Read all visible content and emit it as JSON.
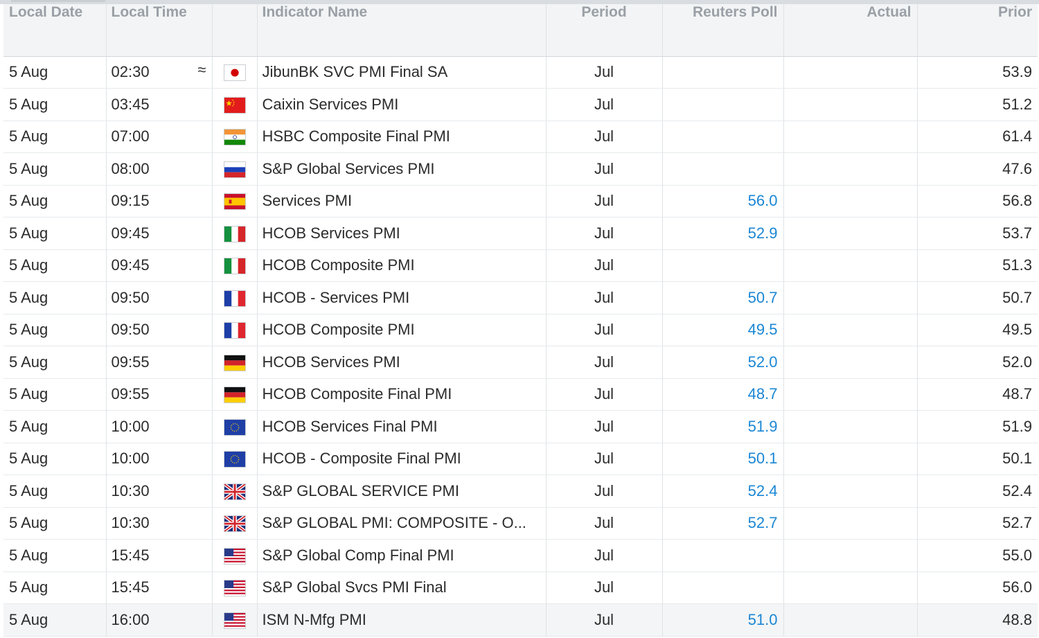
{
  "columns": {
    "local_date": "Local Date",
    "local_time": "Local Time",
    "flag": "",
    "indicator_name": "Indicator Name",
    "period": "Period",
    "reuters_poll": "Reuters Poll",
    "actual": "Actual",
    "prior": "Prior"
  },
  "rows": [
    {
      "date": "5 Aug",
      "time": "02:30",
      "approx": "≈",
      "country": "japan-flag-icon",
      "name": "JibunBK SVC PMI Final SA",
      "period": "Jul",
      "poll": "",
      "actual": "",
      "prior": "53.9"
    },
    {
      "date": "5 Aug",
      "time": "03:45",
      "approx": "",
      "country": "china-flag-icon",
      "name": "Caixin Services PMI",
      "period": "Jul",
      "poll": "",
      "actual": "",
      "prior": "51.2"
    },
    {
      "date": "5 Aug",
      "time": "07:00",
      "approx": "",
      "country": "india-flag-icon",
      "name": "HSBC Composite Final PMI",
      "period": "Jul",
      "poll": "",
      "actual": "",
      "prior": "61.4"
    },
    {
      "date": "5 Aug",
      "time": "08:00",
      "approx": "",
      "country": "russia-flag-icon",
      "name": "S&P Global Services PMI",
      "period": "Jul",
      "poll": "",
      "actual": "",
      "prior": "47.6"
    },
    {
      "date": "5 Aug",
      "time": "09:15",
      "approx": "",
      "country": "spain-flag-icon",
      "name": "Services PMI",
      "period": "Jul",
      "poll": "56.0",
      "actual": "",
      "prior": "56.8"
    },
    {
      "date": "5 Aug",
      "time": "09:45",
      "approx": "",
      "country": "italy-flag-icon",
      "name": "HCOB Services PMI",
      "period": "Jul",
      "poll": "52.9",
      "actual": "",
      "prior": "53.7"
    },
    {
      "date": "5 Aug",
      "time": "09:45",
      "approx": "",
      "country": "italy-flag-icon",
      "name": "HCOB Composite PMI",
      "period": "Jul",
      "poll": "",
      "actual": "",
      "prior": "51.3"
    },
    {
      "date": "5 Aug",
      "time": "09:50",
      "approx": "",
      "country": "france-flag-icon",
      "name": "HCOB - Services PMI",
      "period": "Jul",
      "poll": "50.7",
      "actual": "",
      "prior": "50.7"
    },
    {
      "date": "5 Aug",
      "time": "09:50",
      "approx": "",
      "country": "france-flag-icon",
      "name": "HCOB Composite PMI",
      "period": "Jul",
      "poll": "49.5",
      "actual": "",
      "prior": "49.5"
    },
    {
      "date": "5 Aug",
      "time": "09:55",
      "approx": "",
      "country": "germany-flag-icon",
      "name": "HCOB Services PMI",
      "period": "Jul",
      "poll": "52.0",
      "actual": "",
      "prior": "52.0"
    },
    {
      "date": "5 Aug",
      "time": "09:55",
      "approx": "",
      "country": "germany-flag-icon",
      "name": "HCOB Composite Final PMI",
      "period": "Jul",
      "poll": "48.7",
      "actual": "",
      "prior": "48.7"
    },
    {
      "date": "5 Aug",
      "time": "10:00",
      "approx": "",
      "country": "eu-flag-icon",
      "name": "HCOB Services Final PMI",
      "period": "Jul",
      "poll": "51.9",
      "actual": "",
      "prior": "51.9"
    },
    {
      "date": "5 Aug",
      "time": "10:00",
      "approx": "",
      "country": "eu-flag-icon",
      "name": "HCOB - Composite Final PMI",
      "period": "Jul",
      "poll": "50.1",
      "actual": "",
      "prior": "50.1"
    },
    {
      "date": "5 Aug",
      "time": "10:30",
      "approx": "",
      "country": "uk-flag-icon",
      "name": "S&P GLOBAL SERVICE PMI",
      "period": "Jul",
      "poll": "52.4",
      "actual": "",
      "prior": "52.4"
    },
    {
      "date": "5 Aug",
      "time": "10:30",
      "approx": "",
      "country": "uk-flag-icon",
      "name": "S&P GLOBAL PMI: COMPOSITE - O...",
      "period": "Jul",
      "poll": "52.7",
      "actual": "",
      "prior": "52.7"
    },
    {
      "date": "5 Aug",
      "time": "15:45",
      "approx": "",
      "country": "us-flag-icon",
      "name": "S&P Global Comp Final PMI",
      "period": "Jul",
      "poll": "",
      "actual": "",
      "prior": "55.0"
    },
    {
      "date": "5 Aug",
      "time": "15:45",
      "approx": "",
      "country": "us-flag-icon",
      "name": "S&P Global Svcs PMI Final",
      "period": "Jul",
      "poll": "",
      "actual": "",
      "prior": "56.0"
    },
    {
      "date": "5 Aug",
      "time": "16:00",
      "approx": "",
      "country": "us-flag-icon",
      "name": "ISM N-Mfg PMI",
      "period": "Jul",
      "poll": "51.0",
      "actual": "",
      "prior": "48.8"
    }
  ],
  "colors": {
    "poll_text": "#1a86d4",
    "header_bg": "#f2f4f5",
    "header_text": "#9aa0a6",
    "grid": "#dfe3e6"
  }
}
